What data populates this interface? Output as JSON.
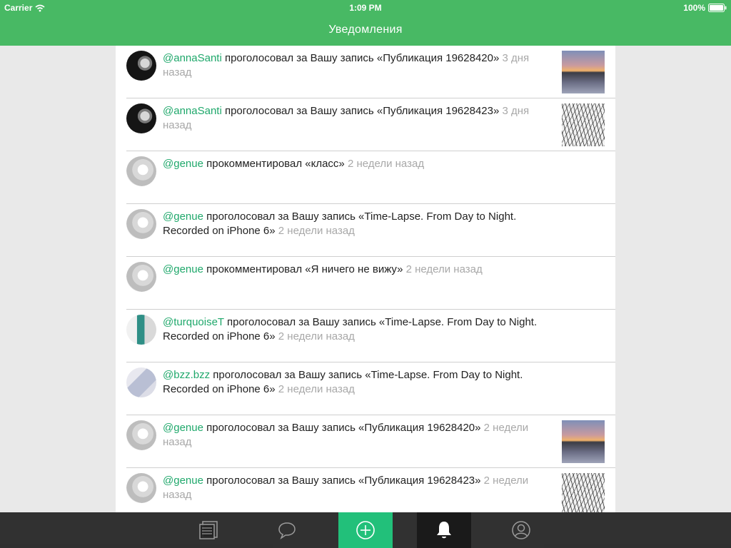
{
  "status_bar": {
    "carrier": "Carrier",
    "time": "1:09 PM",
    "battery": "100%"
  },
  "nav": {
    "title": "Уведомления"
  },
  "notifications": [
    {
      "user": "@annaSanti",
      "text": " проголосовал за Вашу запись «Публикация 19628420» ",
      "time": "3 дня назад",
      "avatar": "dark-portrait",
      "thumbnail": "sunset-lake"
    },
    {
      "user": "@annaSanti",
      "text": " проголосовал за Вашу запись «Публикация 19628423» ",
      "time": "3 дня назад",
      "avatar": "dark-portrait",
      "thumbnail": "snowy-trees"
    },
    {
      "user": "@genue",
      "text": " прокомментировал «класс» ",
      "time": "2 недели назад",
      "avatar": "light-portrait"
    },
    {
      "user": "@genue",
      "text": " проголосовал за Вашу запись «Time-Lapse. From Day to Night. Recorded on iPhone 6» ",
      "time": "2 недели назад",
      "avatar": "light-portrait"
    },
    {
      "user": "@genue",
      "text": " прокомментировал «Я ничего не вижу» ",
      "time": "2 недели назад",
      "avatar": "light-portrait"
    },
    {
      "user": "@turquoiseT",
      "text": " проголосовал за Вашу запись «Time-Lapse. From Day to Night. Recorded on iPhone 6» ",
      "time": "2 недели назад",
      "avatar": "teal-hair-portrait"
    },
    {
      "user": "@bzz.bzz",
      "text": " проголосовал за Вашу запись «Time-Lapse. From Day to Night. Recorded on iPhone 6» ",
      "time": "2 недели назад",
      "avatar": "pale-portrait"
    },
    {
      "user": "@genue",
      "text": " проголосовал за Вашу запись «Публикация 19628420» ",
      "time": "2 недели назад",
      "avatar": "light-portrait",
      "thumbnail": "sunset-lake"
    },
    {
      "user": "@genue",
      "text": " проголосовал за Вашу запись «Публикация 19628423» ",
      "time": "2 недели назад",
      "avatar": "light-portrait",
      "thumbnail": "snowy-trees"
    }
  ],
  "tabbar": {
    "tabs": [
      {
        "name": "feed",
        "icon": "newspaper-icon"
      },
      {
        "name": "messages",
        "icon": "speech-bubble-icon"
      },
      {
        "name": "add",
        "icon": "plus-circle-icon"
      },
      {
        "name": "notifications",
        "icon": "bell-icon",
        "active": true
      },
      {
        "name": "profile",
        "icon": "user-circle-icon"
      }
    ]
  },
  "colors": {
    "brand_green": "#48b964",
    "username_green": "#1fa86b",
    "add_tab_green": "#22c07a",
    "tabbar": "#222222"
  }
}
